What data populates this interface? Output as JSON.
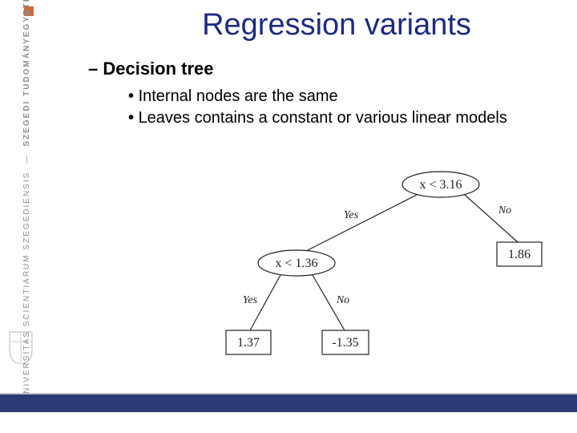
{
  "sidebar": {
    "institution": "UNIVERSITAS SCIENTIARUM SZEGEDIENSIS",
    "sub": "SZEGEDI TUDOMÁNYEGYETEM"
  },
  "title": "Regression variants",
  "subhead": "– Decision tree",
  "bullets": [
    "Internal nodes are the same",
    "Leaves contains a constant or various linear models"
  ],
  "tree": {
    "root_cond": "x < 3.16",
    "root_yes": "Yes",
    "root_no": "No",
    "left_cond": "x < 1.36",
    "left_yes": "Yes",
    "left_no": "No",
    "leaf_ll": "1.37",
    "leaf_lr": "-1.35",
    "leaf_r": "1.86"
  }
}
